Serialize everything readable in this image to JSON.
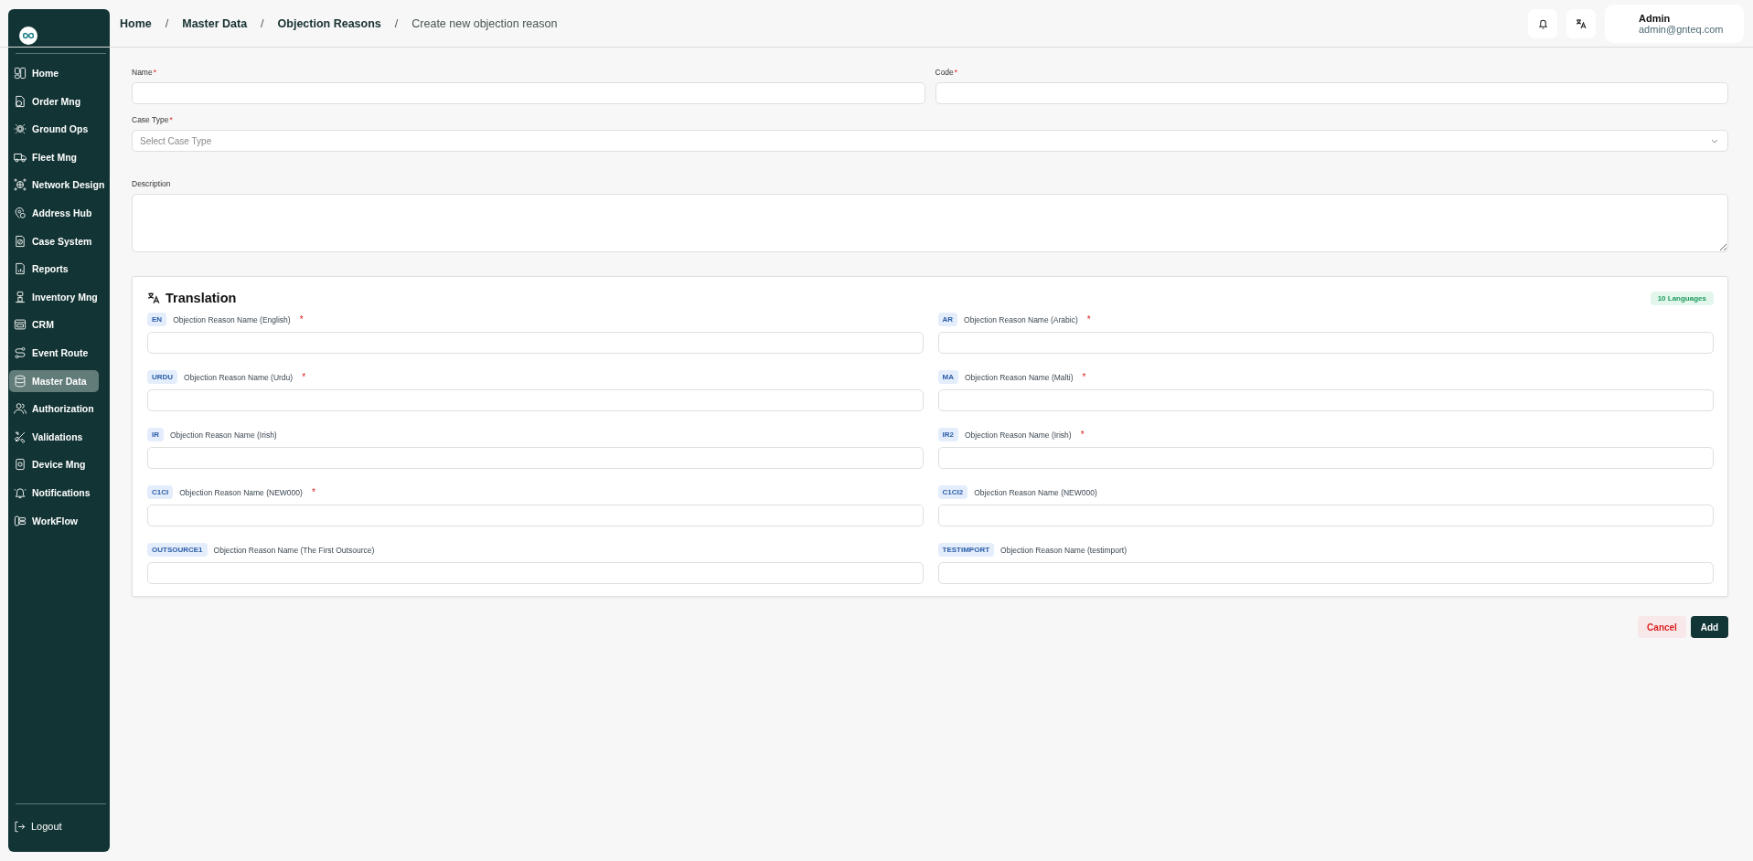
{
  "sidebar": {
    "items": [
      {
        "label": "Home",
        "selected": false
      },
      {
        "label": "Order Mng",
        "selected": false
      },
      {
        "label": "Ground Ops",
        "selected": false
      },
      {
        "label": "Fleet Mng",
        "selected": false
      },
      {
        "label": "Network Design",
        "selected": false
      },
      {
        "label": "Address Hub",
        "selected": false
      },
      {
        "label": "Case System",
        "selected": false
      },
      {
        "label": "Reports",
        "selected": false
      },
      {
        "label": "Inventory Mng",
        "selected": false
      },
      {
        "label": "CRM",
        "selected": false
      },
      {
        "label": "Event Route",
        "selected": false
      },
      {
        "label": "Master Data",
        "selected": true
      },
      {
        "label": "Authorization",
        "selected": false
      },
      {
        "label": "Validations",
        "selected": false
      },
      {
        "label": "Device Mng",
        "selected": false
      },
      {
        "label": "Notifications",
        "selected": false
      },
      {
        "label": "WorkFlow",
        "selected": false
      }
    ],
    "logout": "Logout"
  },
  "breadcrumb": [
    {
      "label": "Home",
      "current": false
    },
    {
      "separator": "/",
      "label": "Master Data",
      "current": false
    },
    {
      "separator": "/",
      "label": "Objection Reasons",
      "current": false
    },
    {
      "separator": "/",
      "label": "Create new objection reason",
      "current": true
    }
  ],
  "user": {
    "name": "Admin",
    "email": "admin@gnteq.com"
  },
  "form": {
    "fields": [
      {
        "label": "Name",
        "marker": "*",
        "kind": "text"
      },
      {
        "label": "Code",
        "marker": "*",
        "kind": "text"
      },
      {
        "label": "Case Type",
        "marker": "*",
        "kind": "select",
        "placeholder": "Select Case Type"
      },
      {
        "label": "Description",
        "kind": "textarea"
      }
    ]
  },
  "translation": {
    "title": "Translation",
    "badge": "10 Languages",
    "languages": [
      {
        "code": "EN",
        "label": "Objection Reason Name (English)",
        "marker": "*"
      },
      {
        "code": "AR",
        "label": "Objection Reason Name (Arabic)",
        "marker": "*"
      },
      {
        "code": "URDU",
        "label": "Objection Reason Name (Urdu)",
        "marker": "*"
      },
      {
        "code": "MA",
        "label": "Objection Reason Name (Malti)",
        "marker": "*"
      },
      {
        "code": "IR",
        "label": "Objection Reason Name (Irish)"
      },
      {
        "code": "IR2",
        "label": "Objection Reason Name (Irish)",
        "marker": "*"
      },
      {
        "code": "C1CI",
        "label": "Objection Reason Name (NEW000)",
        "marker": "*"
      },
      {
        "code": "C1CI2",
        "label": "Objection Reason Name (NEW000)"
      },
      {
        "code": "OUTSOURCE1",
        "label": "Objection Reason Name (The First Outsource)"
      },
      {
        "code": "TESTIMPORT",
        "label": "Objection Reason Name (testimport)"
      }
    ]
  },
  "buttons": {
    "cancel": "Cancel",
    "add": "Add"
  }
}
